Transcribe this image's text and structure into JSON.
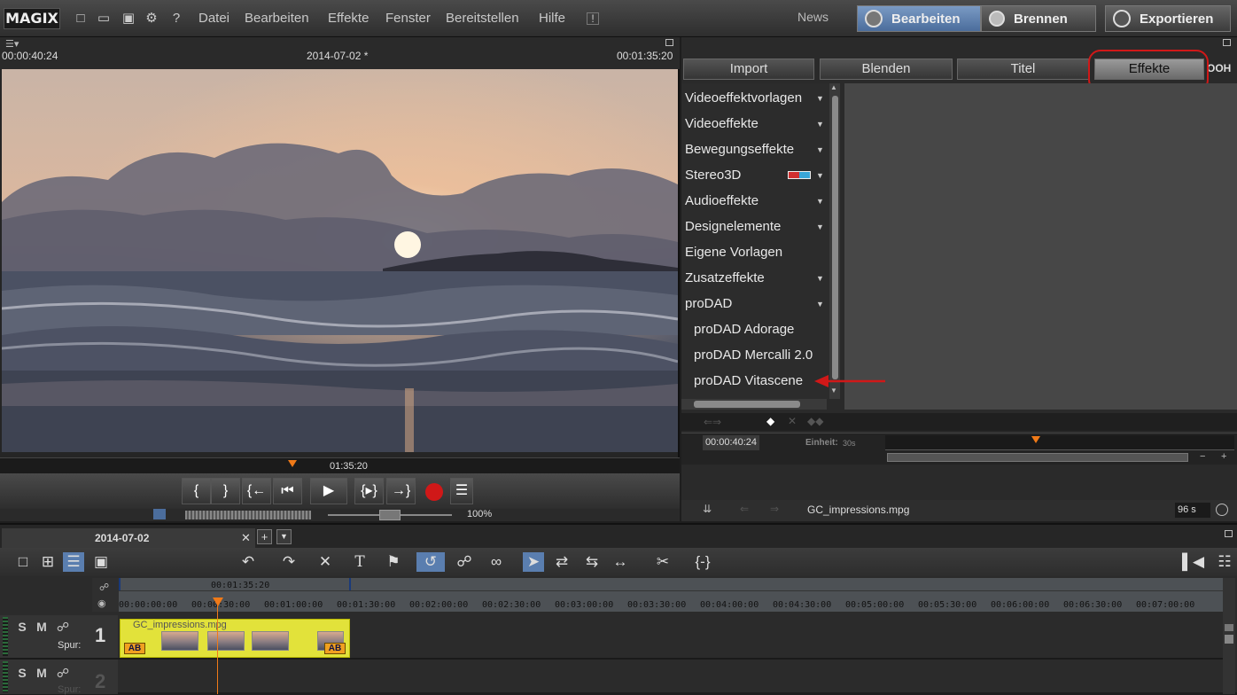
{
  "app": {
    "logo": "MAGIX",
    "menu": [
      "Datei",
      "Bearbeiten",
      "Effekte",
      "Fenster",
      "Bereitstellen",
      "Hilfe"
    ],
    "news": "News",
    "modes": {
      "edit": "Bearbeiten",
      "burn": "Brennen",
      "export": "Exportieren"
    }
  },
  "preview": {
    "timecode_left": "00:00:40:24",
    "project_title": "2014-07-02 *",
    "timecode_right": "00:01:35:20",
    "scrub_time": "01:35:20",
    "zoom": "100%"
  },
  "media_pool": {
    "tabs": [
      "Import",
      "Blenden",
      "Titel",
      "Effekte"
    ],
    "active_tab": "Effekte",
    "categories": [
      {
        "label": "Videoeffektvorlagen",
        "expandable": true
      },
      {
        "label": "Videoeffekte",
        "expandable": true
      },
      {
        "label": "Bewegungseffekte",
        "expandable": true
      },
      {
        "label": "Stereo3D",
        "expandable": true
      },
      {
        "label": "Audioeffekte",
        "expandable": true
      },
      {
        "label": "Designelemente",
        "expandable": true
      },
      {
        "label": "Eigene Vorlagen",
        "expandable": false
      },
      {
        "label": "Zusatzeffekte",
        "expandable": true
      },
      {
        "label": "proDAD",
        "expandable": true
      },
      {
        "label": "proDAD Adorage",
        "expandable": false
      },
      {
        "label": "proDAD Mercalli 2.0",
        "expandable": false
      },
      {
        "label": "proDAD Vitascene",
        "expandable": false
      }
    ],
    "keyframe_time": "00:00:40:24",
    "unit_label": "Einheit:",
    "unit_value": "30s",
    "clip_name": "GC_impressions.mpg",
    "duration": "96 s"
  },
  "timeline": {
    "tab_label": "2014-07-02",
    "range_label": "00:01:35:20",
    "ruler": [
      "00:00:00:00",
      "00:00:30:00",
      "00:01:00:00",
      "00:01:30:00",
      "00:02:00:00",
      "00:02:30:00",
      "00:03:00:00",
      "00:03:30:00",
      "00:04:00:00",
      "00:04:30:00",
      "00:05:00:00",
      "00:05:30:00",
      "00:06:00:00",
      "00:06:30:00",
      "00:07:00:00"
    ],
    "tracks": [
      {
        "number": "1",
        "label": "Spur:"
      },
      {
        "number": "2",
        "label": "Spur:"
      }
    ],
    "clip": {
      "name": "GC_impressions.mpg",
      "badge": "AB"
    }
  },
  "colors": {
    "accent_blue": "#5a7eaf",
    "clip_yellow": "#e2e23a",
    "playhead": "#f07a18",
    "annotation_red": "#d01818"
  }
}
